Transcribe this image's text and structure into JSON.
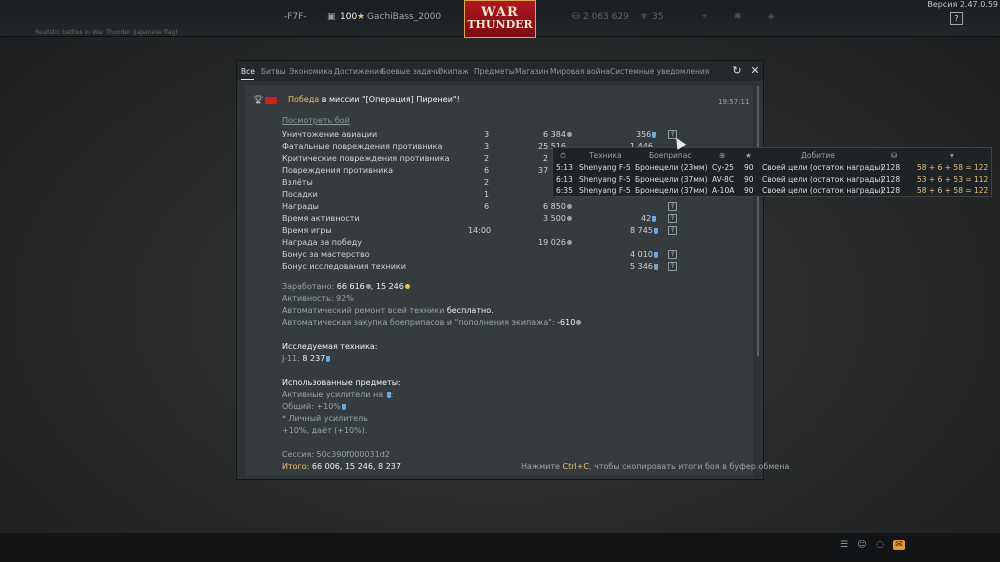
{
  "topbar": {
    "squadron": "-F7F-",
    "level": "100",
    "nickname": "GachiBass_2000",
    "silver": "2 063 629",
    "gold": "35",
    "version": "Версия 2.47.0.59",
    "help": "?",
    "logo_top": "WAR",
    "logo_bottom": "THUNDER",
    "subtitle": "Realistic battles in War Thunder (Japanese flag)"
  },
  "tabs": [
    "Все",
    "Битвы",
    "Экономика",
    "Достижения",
    "Боевые задачи",
    "Экипаж",
    "Предметы",
    "Магазин",
    "Мировая война",
    "Системные уведомления"
  ],
  "message": {
    "title_win": "Победа",
    "title_rest": " в миссии \"[Операция] Пиренеи\"!",
    "time": "19:57:11",
    "view_battle": "Посмотреть бой",
    "rows": [
      {
        "label": "Уничтожение авиации",
        "count": "3",
        "sl": "6 384",
        "rp": "356"
      },
      {
        "label": "Фатальные повреждения противника",
        "count": "3",
        "sl": "25 516",
        "rp": "1 446"
      },
      {
        "label": "Критические повреждения противника",
        "count": "2",
        "sl": "2",
        "rp": ""
      },
      {
        "label": "Повреждения противника",
        "count": "6",
        "sl": "37",
        "rp": ""
      },
      {
        "label": "Взлёты",
        "count": "2",
        "sl": "",
        "rp": ""
      },
      {
        "label": "Посадки",
        "count": "1",
        "sl": "",
        "rp": ""
      },
      {
        "label": "Награды",
        "count": "6",
        "sl": "6 850",
        "rp": ""
      },
      {
        "label": "Время активности",
        "count": "",
        "sl": "3 500",
        "rp": "42"
      },
      {
        "label": "Время игры",
        "count": "14:00",
        "sl": "",
        "rp": "8 745"
      },
      {
        "label": "Награда за победу",
        "count": "",
        "sl": "19 026",
        "rp": ""
      },
      {
        "label": "Бонус за мастерство",
        "count": "",
        "sl": "",
        "rp": "4 010"
      },
      {
        "label": "Бонус исследования техники",
        "count": "",
        "sl": "",
        "rp": "5 346"
      }
    ],
    "earned_label": "Заработано:",
    "earned_sl": " 66 616",
    "earned_rp": ", 15 246",
    "activity": "Активность: 92%",
    "repair_label": "Автоматический ремонт всей техники ",
    "repair_value": "бесплатно.",
    "restock_label": "Автоматическая закупка боеприпасов и \"пополнения экипажа\": ",
    "restock_value": "-610",
    "research_title": "Исследуемая техника:",
    "research_vehicle": "J-11:",
    "research_value": " 8 237",
    "items_title": "Использованные предметы:",
    "boosters_label": "Активные усилители на ",
    "boosters_tail": ":",
    "general": "Общий: +10%",
    "personal_title": "* Личный усилитель",
    "personal_line": "+10%, даёт (+10%).",
    "session": "Сессия: 50c390f000031d2",
    "total_label": "Итого:",
    "total_values": " 66 006, 15 246, 8 237",
    "copy_hint_pre": "Нажмите ",
    "copy_hint_key": "Ctrl+C",
    "copy_hint_post": ", чтобы скопировать итоги боя в буфер обмена"
  },
  "tooltip": {
    "headers": {
      "vehicle": "Техника",
      "ammo": "Боеприпас",
      "finish": "Добитие"
    },
    "rows": [
      {
        "time": "5:13",
        "vehicle": "Shenyang F-5",
        "ammo": "Бронецели (23мм)",
        "target": "Су-25",
        "score": "90",
        "finish": "Своей цели (остаток награды)",
        "sl": "2128",
        "rp": "58 + 6 + 58 = 122"
      },
      {
        "time": "6:13",
        "vehicle": "Shenyang F-5",
        "ammo": "Бронецели (37мм)",
        "target": "AV-8C",
        "score": "90",
        "finish": "Своей цели (остаток награды)",
        "sl": "2128",
        "rp": "53 + 6 + 53 = 112"
      },
      {
        "time": "6:35",
        "vehicle": "Shenyang F-5",
        "ammo": "Бронецели (37мм)",
        "target": "A-10A",
        "score": "90",
        "finish": "Своей цели (остаток награды)",
        "sl": "2128",
        "rp": "58 + 6 + 58 = 122"
      }
    ]
  },
  "icons": {
    "refresh": "refresh-icon",
    "close": "close-icon",
    "trophy": "trophy-icon",
    "flag": "china-flag-icon",
    "silver": "silver-lion-icon",
    "research": "research-points-icon",
    "golden": "golden-eagle-icon"
  },
  "colors": {
    "accent": "#e3c07a",
    "window_bg": "#2f3336",
    "mail": "#e89a3a"
  }
}
